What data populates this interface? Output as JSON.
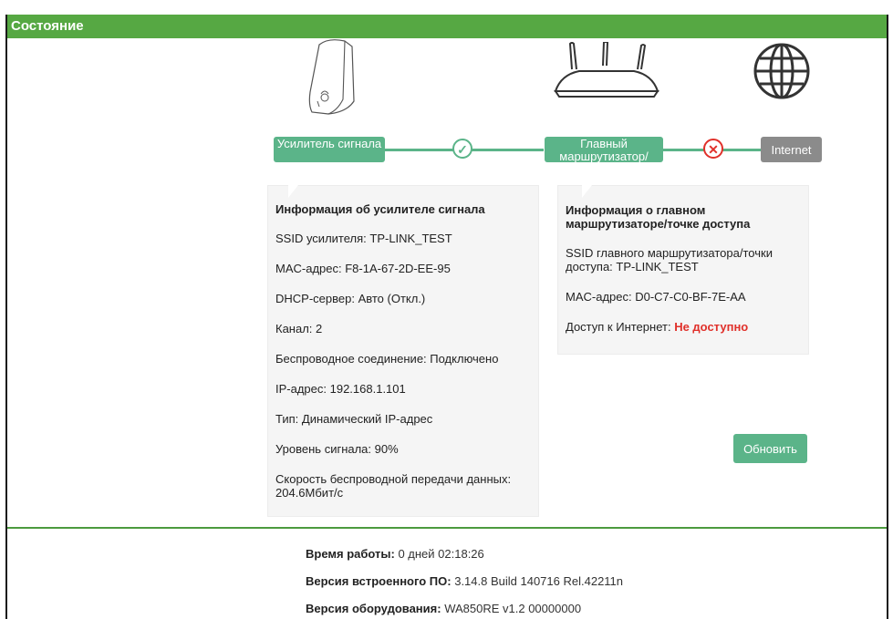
{
  "header": {
    "title": "Состояние"
  },
  "topology": {
    "repeater_label": "Усилитель сигнала",
    "router_label": "Главный маршрутизатор/",
    "internet_label": "Internet",
    "repeater_link_status": "connected",
    "internet_link_status": "disconnected",
    "icons": {
      "repeater": "repeater-device-icon",
      "router": "router-icon",
      "internet": "globe-icon",
      "ok": "check-circle-icon",
      "error": "x-circle-icon"
    }
  },
  "repeater_info": {
    "title": "Информация об усилителе сигнала",
    "rows": [
      "SSID усилителя: TP-LINK_TEST",
      "MAC-адрес: F8-1A-67-2D-EE-95",
      "DHCP-сервер: Авто (Откл.)",
      "Канал: 2",
      "Беспроводное соединение: Подключено",
      "IP-адрес: 192.168.1.101",
      "Тип: Динамический IP-адрес",
      "Уровень сигнала: 90%",
      "Скорость беспроводной передачи данных: 204.6Мбит/с"
    ]
  },
  "router_info": {
    "title": "Информация о главном маршрутизаторе/точке доступа",
    "ssid": "SSID главного маршрутизатора/точки доступа: TP-LINK_TEST",
    "mac": "MAC-адрес: D0-C7-C0-BF-7E-AA",
    "internet_label": "Доступ к Интернет:",
    "internet_value": "Не доступно"
  },
  "actions": {
    "refresh_label": "Обновить"
  },
  "footer": {
    "uptime_label": "Время работы:",
    "uptime_value": "0 дней 02:18:26",
    "firmware_label": "Версия встроенного ПО:",
    "firmware_value": "3.14.8 Build 140716 Rel.42211n",
    "hardware_label": "Версия оборудования:",
    "hardware_value": "WA850RE v1.2 00000000"
  },
  "colors": {
    "accent": "#56a843",
    "node": "#5bb489",
    "error": "#e0302a",
    "internet_node": "#8b8b8b"
  }
}
